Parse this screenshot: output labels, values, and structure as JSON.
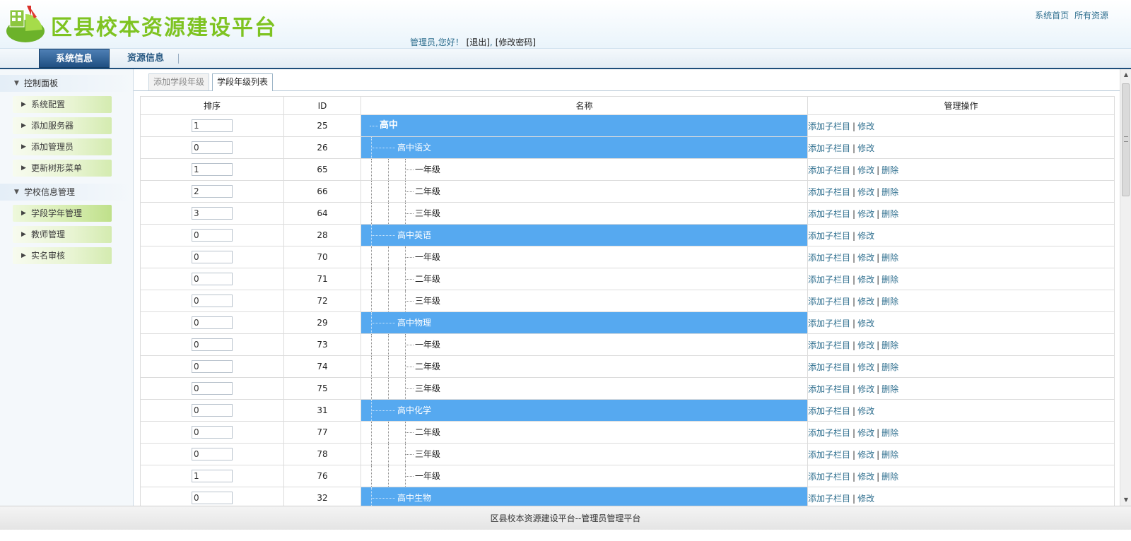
{
  "header": {
    "title": "区县校本资源建设平台",
    "welcome": "管理员,您好！",
    "logout_label": "[退出]",
    "comma": ",",
    "change_password_label": "[修改密码]",
    "top_links": [
      {
        "label": "系统首页"
      },
      {
        "label": "所有资源"
      }
    ]
  },
  "nav": {
    "tabs": [
      {
        "label": "系统信息",
        "active": true
      },
      {
        "label": "资源信息",
        "active": false
      }
    ]
  },
  "sidebar": {
    "groups": [
      {
        "label": "控制面板",
        "items": [
          {
            "label": "系统配置"
          },
          {
            "label": "添加服务器"
          },
          {
            "label": "添加管理员"
          },
          {
            "label": "更新树形菜单"
          }
        ]
      },
      {
        "label": "学校信息管理",
        "items": [
          {
            "label": "学段学年管理",
            "active": true
          },
          {
            "label": "教师管理"
          },
          {
            "label": "实名审核"
          }
        ]
      }
    ]
  },
  "subtabs": [
    {
      "label": "添加学段年级",
      "active": false
    },
    {
      "label": "学段年级列表",
      "active": true
    }
  ],
  "table": {
    "headers": {
      "order": "排序",
      "id": "ID",
      "name": "名称",
      "ops": "管理操作"
    },
    "op_labels": {
      "add_child": "添加子栏目",
      "edit": "修改",
      "delete": "删除",
      "sep": "|"
    },
    "rows": [
      {
        "order": "1",
        "id": "25",
        "name": "高中",
        "level": 0,
        "highlight": true,
        "deletable": false
      },
      {
        "order": "0",
        "id": "26",
        "name": "高中语文",
        "level": 1,
        "highlight": true,
        "deletable": false
      },
      {
        "order": "1",
        "id": "65",
        "name": "一年级",
        "level": 2,
        "highlight": false,
        "deletable": true
      },
      {
        "order": "2",
        "id": "66",
        "name": "二年级",
        "level": 2,
        "highlight": false,
        "deletable": true
      },
      {
        "order": "3",
        "id": "64",
        "name": "三年级",
        "level": 2,
        "highlight": false,
        "deletable": true
      },
      {
        "order": "0",
        "id": "28",
        "name": "高中英语",
        "level": 1,
        "highlight": true,
        "deletable": false
      },
      {
        "order": "0",
        "id": "70",
        "name": "一年级",
        "level": 2,
        "highlight": false,
        "deletable": true
      },
      {
        "order": "0",
        "id": "71",
        "name": "二年级",
        "level": 2,
        "highlight": false,
        "deletable": true
      },
      {
        "order": "0",
        "id": "72",
        "name": "三年级",
        "level": 2,
        "highlight": false,
        "deletable": true
      },
      {
        "order": "0",
        "id": "29",
        "name": "高中物理",
        "level": 1,
        "highlight": true,
        "deletable": false
      },
      {
        "order": "0",
        "id": "73",
        "name": "一年级",
        "level": 2,
        "highlight": false,
        "deletable": true
      },
      {
        "order": "0",
        "id": "74",
        "name": "二年级",
        "level": 2,
        "highlight": false,
        "deletable": true
      },
      {
        "order": "0",
        "id": "75",
        "name": "三年级",
        "level": 2,
        "highlight": false,
        "deletable": true
      },
      {
        "order": "0",
        "id": "31",
        "name": "高中化学",
        "level": 1,
        "highlight": true,
        "deletable": false
      },
      {
        "order": "0",
        "id": "77",
        "name": "二年级",
        "level": 2,
        "highlight": false,
        "deletable": true
      },
      {
        "order": "0",
        "id": "78",
        "name": "三年级",
        "level": 2,
        "highlight": false,
        "deletable": true
      },
      {
        "order": "1",
        "id": "76",
        "name": "一年级",
        "level": 2,
        "highlight": false,
        "deletable": true
      },
      {
        "order": "0",
        "id": "32",
        "name": "高中生物",
        "level": 1,
        "highlight": true,
        "deletable": false
      }
    ]
  },
  "footer": {
    "text": "区县校本资源建设平台--管理员管理平台"
  },
  "colors": {
    "accent_green": "#7ec321",
    "nav_active": "#1f4f82",
    "row_highlight": "#56a9f0",
    "link": "#2f6f8f"
  },
  "icons": {
    "logo": "pie-chart-building-logo-icon",
    "group_toggle": "triangle-down-icon",
    "item_arrow": "triangle-right-icon"
  }
}
